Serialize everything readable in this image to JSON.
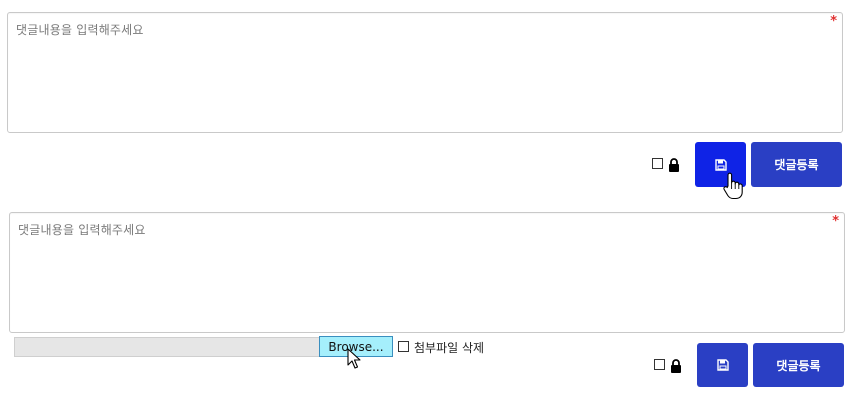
{
  "comment_form_1": {
    "content_placeholder": "댓글내용을 입력해주세요",
    "required_mark": "*",
    "submit_label": "댓글등록"
  },
  "comment_form_2": {
    "content_placeholder": "댓글내용을 입력해주세요",
    "required_mark": "*",
    "browse_label": "Browse...",
    "delete_attachment_label": "첨부파일 삭제",
    "submit_label": "댓글등록"
  },
  "icons": {
    "lock": "lock-icon",
    "save": "floppy-disk-icon",
    "hand_pointer": "hand-pointer-cursor",
    "arrow_pointer": "arrow-pointer-cursor"
  },
  "colors": {
    "primary_button": "#2a3fc4",
    "hover_button": "#0f23e6",
    "browse_button": "#a5effc",
    "required_mark": "#e03030"
  }
}
